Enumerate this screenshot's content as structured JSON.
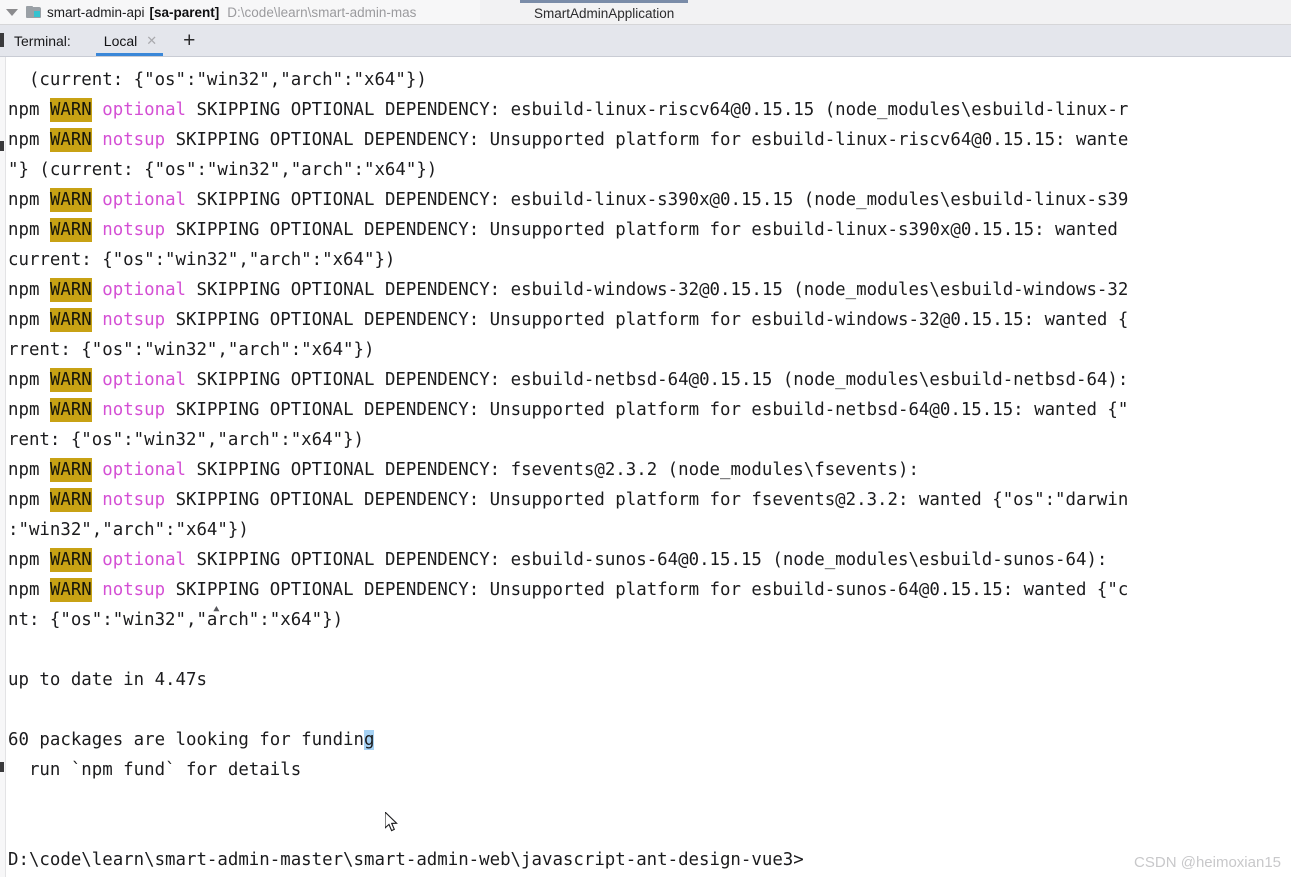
{
  "titlebar": {
    "collapse_icon": "triangle-down-icon",
    "folder_icon": "folder-icon",
    "project_name": "smart-admin-api",
    "module_name": "[sa-parent]",
    "project_path": "D:\\code\\learn\\smart-admin-mas",
    "run_configuration": "SmartAdminApplication"
  },
  "terminal_tabs": {
    "label": "Terminal:",
    "active_tab": "Local",
    "close_icon": "close-icon",
    "add_icon": "plus-icon"
  },
  "terminal": {
    "warn_badge_text": "WARN",
    "warn_badge_bg": "#c8a214",
    "magenta_token_color": "#d44fd4",
    "selection_color": "#a6d2f4",
    "prompt": "D:\\code\\learn\\smart-admin-master\\smart-admin-web\\javascript-ant-design-vue3>",
    "lines": [
      {
        "type": "plain",
        "text": "  (current: {\"os\":\"win32\",\"arch\":\"x64\"})"
      },
      {
        "type": "warn",
        "tag": "optional",
        "rest": " SKIPPING OPTIONAL DEPENDENCY: esbuild-linux-riscv64@0.15.15 (node_modules\\esbuild-linux-r"
      },
      {
        "type": "warn",
        "tag": "notsup",
        "rest": " SKIPPING OPTIONAL DEPENDENCY: Unsupported platform for esbuild-linux-riscv64@0.15.15: wante"
      },
      {
        "type": "plain",
        "text": "\"} (current: {\"os\":\"win32\",\"arch\":\"x64\"})"
      },
      {
        "type": "warn",
        "tag": "optional",
        "rest": " SKIPPING OPTIONAL DEPENDENCY: esbuild-linux-s390x@0.15.15 (node_modules\\esbuild-linux-s39"
      },
      {
        "type": "warn",
        "tag": "notsup",
        "rest": " SKIPPING OPTIONAL DEPENDENCY: Unsupported platform for esbuild-linux-s390x@0.15.15: wanted"
      },
      {
        "type": "plain",
        "text": "current: {\"os\":\"win32\",\"arch\":\"x64\"})"
      },
      {
        "type": "warn",
        "tag": "optional",
        "rest": " SKIPPING OPTIONAL DEPENDENCY: esbuild-windows-32@0.15.15 (node_modules\\esbuild-windows-32"
      },
      {
        "type": "warn",
        "tag": "notsup",
        "rest": " SKIPPING OPTIONAL DEPENDENCY: Unsupported platform for esbuild-windows-32@0.15.15: wanted {"
      },
      {
        "type": "plain",
        "text": "rrent: {\"os\":\"win32\",\"arch\":\"x64\"})"
      },
      {
        "type": "warn",
        "tag": "optional",
        "rest": " SKIPPING OPTIONAL DEPENDENCY: esbuild-netbsd-64@0.15.15 (node_modules\\esbuild-netbsd-64):"
      },
      {
        "type": "warn",
        "tag": "notsup",
        "rest": " SKIPPING OPTIONAL DEPENDENCY: Unsupported platform for esbuild-netbsd-64@0.15.15: wanted {\""
      },
      {
        "type": "plain",
        "text": "rent: {\"os\":\"win32\",\"arch\":\"x64\"})"
      },
      {
        "type": "warn",
        "tag": "optional",
        "rest": " SKIPPING OPTIONAL DEPENDENCY: fsevents@2.3.2 (node_modules\\fsevents):"
      },
      {
        "type": "warn",
        "tag": "notsup",
        "rest": " SKIPPING OPTIONAL DEPENDENCY: Unsupported platform for fsevents@2.3.2: wanted {\"os\":\"darwin"
      },
      {
        "type": "plain",
        "text": ":\"win32\",\"arch\":\"x64\"})"
      },
      {
        "type": "warn",
        "tag": "optional",
        "rest": " SKIPPING OPTIONAL DEPENDENCY: esbuild-sunos-64@0.15.15 (node_modules\\esbuild-sunos-64):"
      },
      {
        "type": "warn",
        "tag": "notsup",
        "rest": " SKIPPING OPTIONAL DEPENDENCY: Unsupported platform for esbuild-sunos-64@0.15.15: wanted {\"c"
      },
      {
        "type": "plain",
        "text": "nt: {\"os\":\"win32\",\"arch\":\"x64\"})"
      },
      {
        "type": "blank",
        "text": ""
      },
      {
        "type": "plain",
        "text": "up to date in 4.47s"
      },
      {
        "type": "blank",
        "text": ""
      },
      {
        "type": "selection",
        "pre": "60 packages are looking for fundin",
        "sel": "g"
      },
      {
        "type": "plain",
        "text": "  run `npm fund` for details"
      },
      {
        "type": "blank",
        "text": ""
      },
      {
        "type": "blank",
        "text": ""
      },
      {
        "type": "prompt",
        "text": "D:\\code\\learn\\smart-admin-master\\smart-admin-web\\javascript-ant-design-vue3>"
      }
    ]
  },
  "watermark": {
    "text": "CSDN @heimoxian15"
  }
}
